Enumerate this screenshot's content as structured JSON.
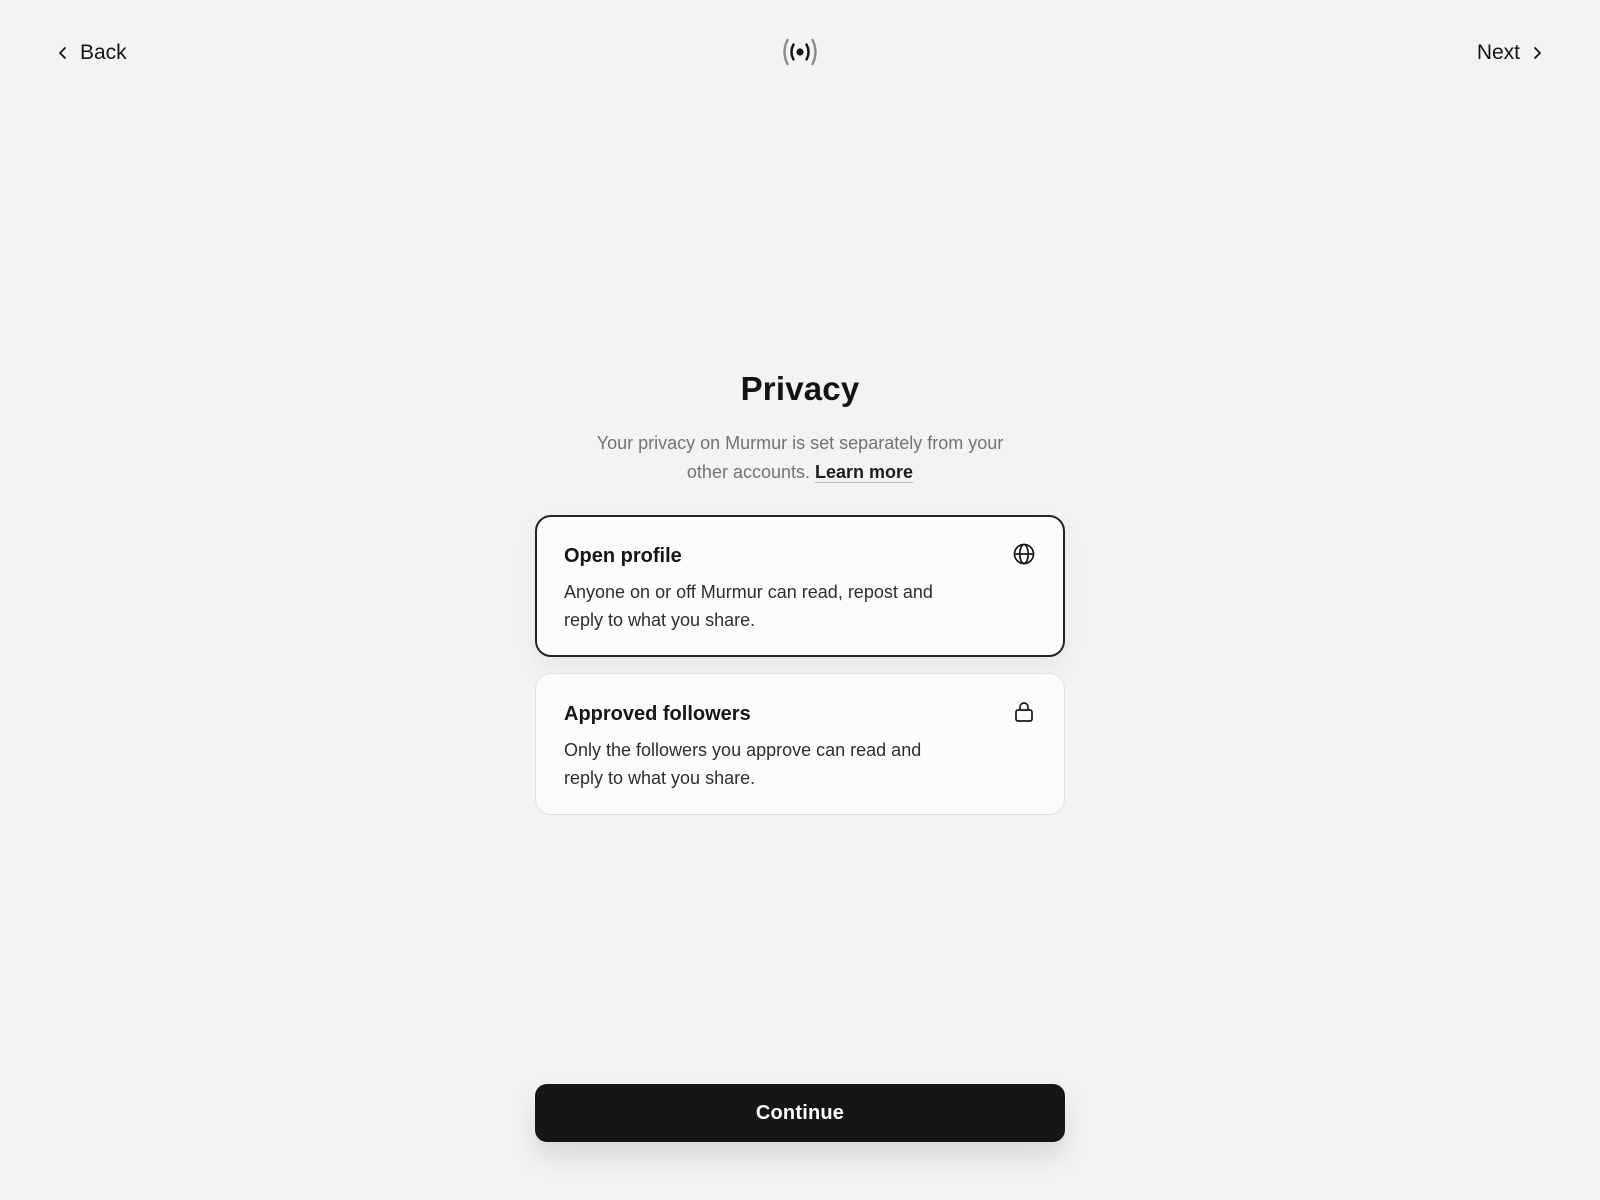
{
  "header": {
    "back_label": "Back",
    "next_label": "Next",
    "logo_icon": "broadcast-icon"
  },
  "main": {
    "title": "Privacy",
    "subtitle": "Your privacy on Murmur is set separately from your other accounts.",
    "learn_more_label": "Learn more"
  },
  "options": [
    {
      "title": "Open profile",
      "description": "Anyone on or off Murmur can read, repost and reply to what you share.",
      "icon": "globe-icon",
      "selected": true
    },
    {
      "title": "Approved followers",
      "description": "Only the followers you approve can read and reply to what you share.",
      "icon": "lock-icon",
      "selected": false
    }
  ],
  "footer": {
    "continue_label": "Continue"
  },
  "colors": {
    "background": "#f4f3f1",
    "primary_button": "#161616",
    "selected_border": "#242424"
  }
}
